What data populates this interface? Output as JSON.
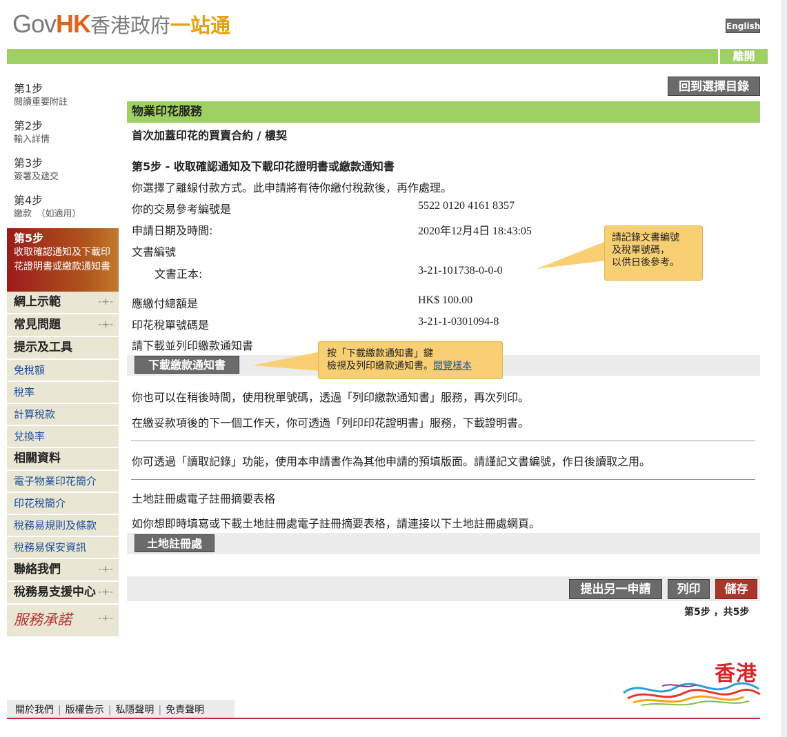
{
  "header": {
    "logo_gov": "Gov",
    "logo_hk": "HK",
    "logo_zh_1": "香港政府",
    "logo_zh_2": "一站通",
    "english_label": "English",
    "exit_label": "離開"
  },
  "sidebar": {
    "steps": [
      {
        "title": "第1步",
        "desc": "閱讀重要附註"
      },
      {
        "title": "第2步",
        "desc": "輸入詳情"
      },
      {
        "title": "第3步",
        "desc": "簽署及遞交"
      },
      {
        "title": "第4步",
        "desc": "繳款　（如適用）"
      }
    ],
    "active_step": {
      "title": "第5步",
      "desc": "收取確認通知及下載印花證明書或繳款通知書"
    },
    "nav_demo": "網上示範",
    "nav_faq": "常見問題",
    "nav_tips": "提示及工具",
    "tips_links": [
      "免稅額",
      "稅率",
      "計算稅款",
      "兌換率"
    ],
    "nav_related": "相關資料",
    "related_links": [
      "電子物業印花簡介",
      "印花稅簡介",
      "稅務易規則及條款",
      "稅務易保安資訊"
    ],
    "nav_contact": "聯絡我們",
    "nav_support": "稅務易支援中心",
    "nav_promise": "服務承諾",
    "plus_symbol": "-+-"
  },
  "main": {
    "back_button": "回到選擇目錄",
    "service_title": "物業印花服務",
    "service_subtitle": "首次加蓋印花的買賣合約 / 樓契",
    "step_heading": "第5步 - 收取確認通知及下載印花證明書或繳款通知書",
    "offline_notice": "你選擇了離線付款方式。此申請將有待你繳付稅款後，再作處理。",
    "ref_label": "你的交易參考編號是",
    "ref_value": "5522 0120 4161 8357",
    "date_label": "申請日期及時間:",
    "date_value": "2020年12月4日 18:43:05",
    "doc_no_label": "文書編號",
    "doc_original_label": "文書正本:",
    "doc_original_value": "3-21-101738-0-0-0",
    "amount_label": "應繳付總額是",
    "amount_value": "HK$ 100.00",
    "demand_no_label": "印花稅單號碼是",
    "demand_no_value": "3-21-1-0301094-8",
    "download_prompt": "請下載並列印繳款通知書",
    "download_button": "下載繳款通知書",
    "reprint_text": "你也可以在稍後時間，使用稅單號碼，透過「列印繳款通知書」服務，再次列印。",
    "certificate_text": "在繳妥款項後的下一個工作天，你可透過「列印印花證明書」服務，下載證明書。",
    "retrieve_text": "你可透過「讀取記錄」功能，使用本申請書作為其他申請的預填版面。請謹記文書編號，作日後讀取之用。",
    "land_title": "土地註冊處電子註冊摘要表格",
    "land_text": "如你想即時填寫或下載土地註冊處電子註冊摘要表格，請連接以下土地註冊處網頁。",
    "land_button": "土地註冊處",
    "submit_another": "提出另一申請",
    "print_label": "列印",
    "save_label": "儲存",
    "step_counter": "第5步 ，共5步"
  },
  "tooltips": {
    "record_tip": "請記錄文書編號及稅單號碼，以供日後參考。",
    "record_tip_lines": [
      "請記錄文書編號",
      "及稅單號碼，",
      "以供日後參考。"
    ],
    "download_tip_line1": "按「下載繳款通知書」鍵",
    "download_tip_line2": "檢視及列印繳款通知書。",
    "download_tip_link": "閱覽樣本"
  },
  "footer": {
    "links": [
      "關於我們",
      "版權告示",
      "私隱聲明",
      "免責聲明"
    ],
    "brand": "香港"
  },
  "colors": {
    "green": "#9fd063",
    "active_step": "#9b1b1b",
    "save_button": "#a9362a",
    "nav_bg": "#e9e6d3",
    "link": "#1b4f9c"
  }
}
